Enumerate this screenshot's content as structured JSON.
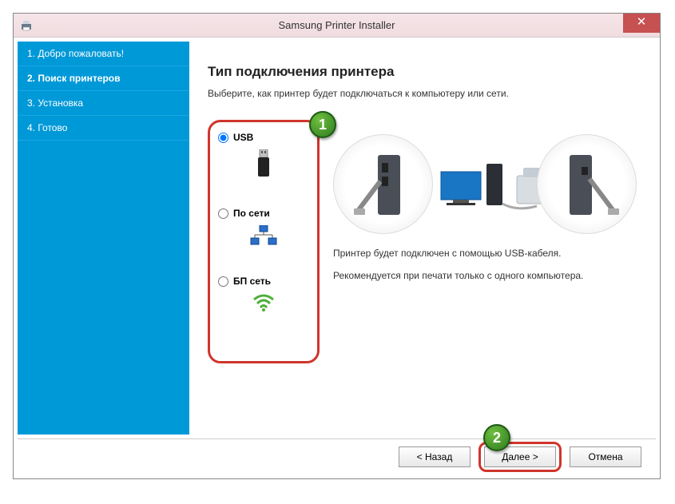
{
  "window": {
    "title": "Samsung Printer Installer"
  },
  "sidebar": {
    "steps": [
      {
        "label": "1. Добро пожаловать!"
      },
      {
        "label": "2. Поиск принтеров"
      },
      {
        "label": "3. Установка"
      },
      {
        "label": "4. Готово"
      }
    ]
  },
  "content": {
    "heading": "Тип подключения принтера",
    "subtitle": "Выберите, как принтер будет подключаться к компьютеру или сети."
  },
  "options": {
    "usb": {
      "label": "USB",
      "selected": true
    },
    "network": {
      "label": "По сети",
      "selected": false
    },
    "wireless": {
      "label": "БП сеть",
      "selected": false
    }
  },
  "description": {
    "line1": "Принтер будет подключен с помощью USB-кабеля.",
    "line2": "Рекомендуется при печати только с одного компьютера."
  },
  "footer": {
    "back": "< Назад",
    "next": "Далее >",
    "cancel": "Отмена"
  },
  "badges": {
    "one": "1",
    "two": "2"
  }
}
